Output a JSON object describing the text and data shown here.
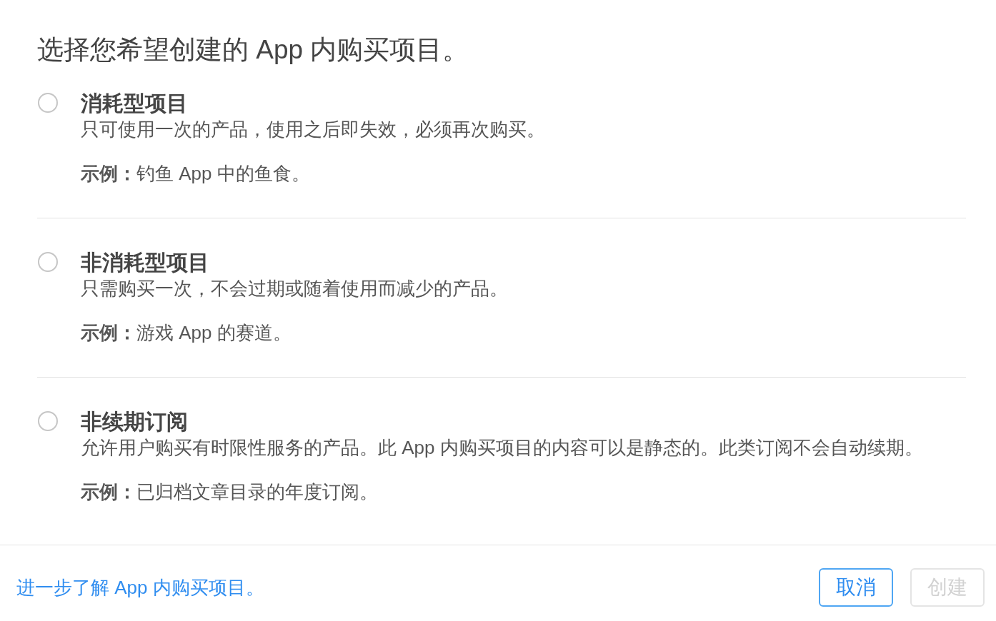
{
  "heading": "选择您希望创建的 App 内购买项目。",
  "options": [
    {
      "title": "消耗型项目",
      "description": "只可使用一次的产品，使用之后即失效，必须再次购买。",
      "example": "**示例：**钓鱼 App 中的鱼食。",
      "selected": false
    },
    {
      "title": "非消耗型项目",
      "description": "只需购买一次，不会过期或随着使用而减少的产品。",
      "example": "**示例：**游戏 App 的赛道。",
      "selected": false
    },
    {
      "title": "非续期订阅",
      "description": "允许用户购买有时限性服务的产品。此 App 内购买项目的内容可以是静态的。此类订阅不会自动续期。",
      "example": "**示例：**已归档文章目录的年度订阅。",
      "selected": false
    }
  ],
  "footer": {
    "link": "进一步了解 App 内购买项目。",
    "buttons": [
      {
        "label": "取消",
        "disabled": false
      },
      {
        "label": "创建",
        "disabled": true
      }
    ]
  }
}
